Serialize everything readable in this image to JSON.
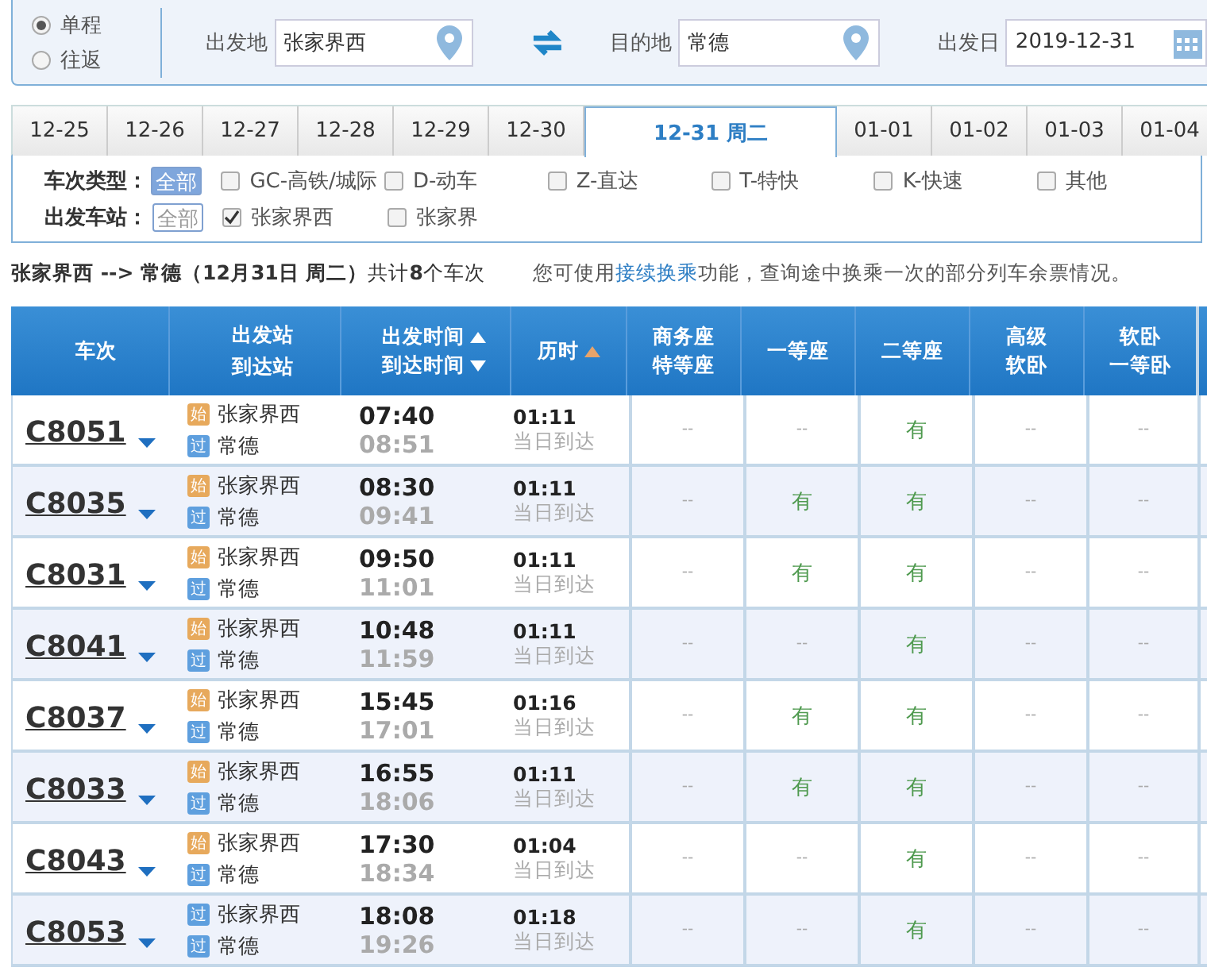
{
  "trip_type": [
    {
      "label": "单程",
      "selected": true
    },
    {
      "label": "往返",
      "selected": false
    }
  ],
  "from": {
    "label": "出发地",
    "value": "张家界西"
  },
  "to": {
    "label": "目的地",
    "value": "常德"
  },
  "date": {
    "label": "出发日",
    "value": "2019-12-31"
  },
  "date_tabs": [
    {
      "label": "12-25",
      "selected": false
    },
    {
      "label": "12-26",
      "selected": false
    },
    {
      "label": "12-27",
      "selected": false
    },
    {
      "label": "12-28",
      "selected": false
    },
    {
      "label": "12-29",
      "selected": false
    },
    {
      "label": "12-30",
      "selected": false
    },
    {
      "label": "12-31",
      "weekday": "周二",
      "selected": true
    },
    {
      "label": "01-01",
      "selected": false
    },
    {
      "label": "01-02",
      "selected": false
    },
    {
      "label": "01-03",
      "selected": false
    },
    {
      "label": "01-04",
      "selected": false
    }
  ],
  "filters": [
    {
      "label": "车次类型：",
      "all": {
        "label": "全部",
        "selected": true
      },
      "options": [
        {
          "label": "GC-高铁/城际",
          "checked": false
        },
        {
          "label": "D-动车",
          "checked": false
        },
        {
          "label": "Z-直达",
          "checked": false
        },
        {
          "label": "T-特快",
          "checked": false
        },
        {
          "label": "K-快速",
          "checked": false
        },
        {
          "label": "其他",
          "checked": false
        }
      ]
    },
    {
      "label": "出发车站：",
      "all": {
        "label": "全部",
        "selected": false
      },
      "options": [
        {
          "label": "张家界西",
          "checked": true
        },
        {
          "label": "张家界",
          "checked": false
        }
      ]
    }
  ],
  "summary": "**张家界西 --> 常德（12月31日 周二）**共计**8**个车次",
  "hint": {
    "before": "您可使用",
    "link": "接续换乘",
    "after": "功能，查询途中换乘一次的部分列车余票情况。"
  },
  "table": {
    "columns": [
      {
        "lines": [
          {
            "text": "车次"
          }
        ]
      },
      {
        "lines": [
          {
            "text": "出发站"
          },
          {
            "text": "到达站"
          }
        ]
      },
      {
        "lines": [
          {
            "text": "出发时间",
            "sortable": true,
            "descending": false,
            "active": false
          },
          {
            "text": "到达时间",
            "sortable": true,
            "descending": true,
            "active": false
          }
        ]
      },
      {
        "lines": [
          {
            "text": "历时",
            "sortable": true,
            "descending": false,
            "active": true
          }
        ]
      },
      {
        "lines": [
          {
            "text": "商务座"
          },
          {
            "text": "特等座"
          }
        ]
      },
      {
        "lines": [
          {
            "text": "一等座"
          }
        ]
      },
      {
        "lines": [
          {
            "text": "二等座"
          }
        ]
      },
      {
        "lines": [
          {
            "text": "高级"
          },
          {
            "text": "软卧"
          }
        ]
      },
      {
        "lines": [
          {
            "text": "软卧"
          },
          {
            "text": "一等卧"
          }
        ]
      }
    ],
    "rows": [
      {
        "train": "C8051",
        "from": {
          "badge": "始",
          "kind": "start",
          "name": "张家界西"
        },
        "to": {
          "badge": "过",
          "kind": "pass",
          "name": "常德"
        },
        "depart": "07:40",
        "arrive": "08:51",
        "duration": "01:11",
        "arrival_day": "当日到达",
        "seats": [
          {
            "text": "--",
            "available": false
          },
          {
            "text": "--",
            "available": false
          },
          {
            "text": "有",
            "available": true
          },
          {
            "text": "--",
            "available": false
          },
          {
            "text": "--",
            "available": false
          }
        ]
      },
      {
        "train": "C8035",
        "from": {
          "badge": "始",
          "kind": "start",
          "name": "张家界西"
        },
        "to": {
          "badge": "过",
          "kind": "pass",
          "name": "常德"
        },
        "depart": "08:30",
        "arrive": "09:41",
        "duration": "01:11",
        "arrival_day": "当日到达",
        "seats": [
          {
            "text": "--",
            "available": false
          },
          {
            "text": "有",
            "available": true
          },
          {
            "text": "有",
            "available": true
          },
          {
            "text": "--",
            "available": false
          },
          {
            "text": "--",
            "available": false
          }
        ]
      },
      {
        "train": "C8031",
        "from": {
          "badge": "始",
          "kind": "start",
          "name": "张家界西"
        },
        "to": {
          "badge": "过",
          "kind": "pass",
          "name": "常德"
        },
        "depart": "09:50",
        "arrive": "11:01",
        "duration": "01:11",
        "arrival_day": "当日到达",
        "seats": [
          {
            "text": "--",
            "available": false
          },
          {
            "text": "有",
            "available": true
          },
          {
            "text": "有",
            "available": true
          },
          {
            "text": "--",
            "available": false
          },
          {
            "text": "--",
            "available": false
          }
        ]
      },
      {
        "train": "C8041",
        "from": {
          "badge": "始",
          "kind": "start",
          "name": "张家界西"
        },
        "to": {
          "badge": "过",
          "kind": "pass",
          "name": "常德"
        },
        "depart": "10:48",
        "arrive": "11:59",
        "duration": "01:11",
        "arrival_day": "当日到达",
        "seats": [
          {
            "text": "--",
            "available": false
          },
          {
            "text": "--",
            "available": false
          },
          {
            "text": "有",
            "available": true
          },
          {
            "text": "--",
            "available": false
          },
          {
            "text": "--",
            "available": false
          }
        ]
      },
      {
        "train": "C8037",
        "from": {
          "badge": "始",
          "kind": "start",
          "name": "张家界西"
        },
        "to": {
          "badge": "过",
          "kind": "pass",
          "name": "常德"
        },
        "depart": "15:45",
        "arrive": "17:01",
        "duration": "01:16",
        "arrival_day": "当日到达",
        "seats": [
          {
            "text": "--",
            "available": false
          },
          {
            "text": "有",
            "available": true
          },
          {
            "text": "有",
            "available": true
          },
          {
            "text": "--",
            "available": false
          },
          {
            "text": "--",
            "available": false
          }
        ]
      },
      {
        "train": "C8033",
        "from": {
          "badge": "始",
          "kind": "start",
          "name": "张家界西"
        },
        "to": {
          "badge": "过",
          "kind": "pass",
          "name": "常德"
        },
        "depart": "16:55",
        "arrive": "18:06",
        "duration": "01:11",
        "arrival_day": "当日到达",
        "seats": [
          {
            "text": "--",
            "available": false
          },
          {
            "text": "有",
            "available": true
          },
          {
            "text": "有",
            "available": true
          },
          {
            "text": "--",
            "available": false
          },
          {
            "text": "--",
            "available": false
          }
        ]
      },
      {
        "train": "C8043",
        "from": {
          "badge": "始",
          "kind": "start",
          "name": "张家界西"
        },
        "to": {
          "badge": "过",
          "kind": "pass",
          "name": "常德"
        },
        "depart": "17:30",
        "arrive": "18:34",
        "duration": "01:04",
        "arrival_day": "当日到达",
        "seats": [
          {
            "text": "--",
            "available": false
          },
          {
            "text": "--",
            "available": false
          },
          {
            "text": "有",
            "available": true
          },
          {
            "text": "--",
            "available": false
          },
          {
            "text": "--",
            "available": false
          }
        ]
      },
      {
        "train": "C8053",
        "from": {
          "badge": "过",
          "kind": "pass",
          "name": "张家界西"
        },
        "to": {
          "badge": "过",
          "kind": "pass",
          "name": "常德"
        },
        "depart": "18:08",
        "arrive": "19:26",
        "duration": "01:18",
        "arrival_day": "当日到达",
        "seats": [
          {
            "text": "--",
            "available": false
          },
          {
            "text": "--",
            "available": false
          },
          {
            "text": "有",
            "available": true
          },
          {
            "text": "--",
            "available": false
          },
          {
            "text": "--",
            "available": false
          }
        ]
      }
    ]
  }
}
